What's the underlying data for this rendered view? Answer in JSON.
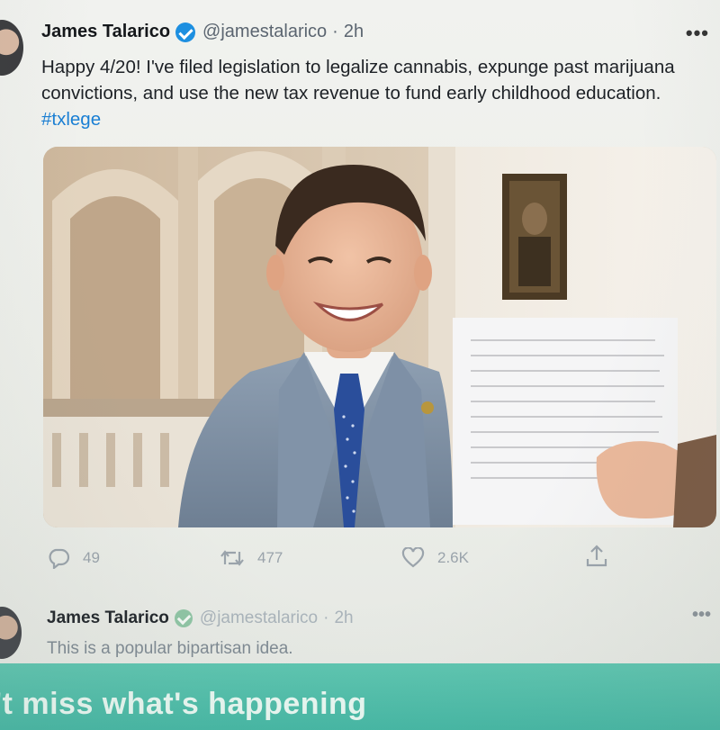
{
  "tweet": {
    "author_name": "James Talarico",
    "handle": "@jamestalarico",
    "separator": "·",
    "time": "2h",
    "more_label": "•••",
    "text_main": "Happy 4/20! I've filed legislation to legalize cannabis, expunge past marijuana convictions, and use the new tax revenue to fund early childhood education. ",
    "hashtag": "#txlege",
    "icons": {
      "verified": "verified-badge-icon",
      "more": "more-options-icon",
      "reply": "reply-icon",
      "retweet": "retweet-icon",
      "like": "heart-icon",
      "share": "share-icon"
    },
    "colors": {
      "link": "#1a7fd4",
      "verified": "#1d8fe0"
    },
    "metrics": {
      "replies": "49",
      "retweets": "477",
      "likes": "2.6K"
    }
  },
  "reply_tweet": {
    "author_name": "James Talarico",
    "handle": "@jamestalarico",
    "separator": "·",
    "time": "2h",
    "more_label": "•••",
    "text": "This is a popular bipartisan idea."
  },
  "banner": {
    "text": "'t miss what's happening",
    "color": "#4fbca8"
  }
}
